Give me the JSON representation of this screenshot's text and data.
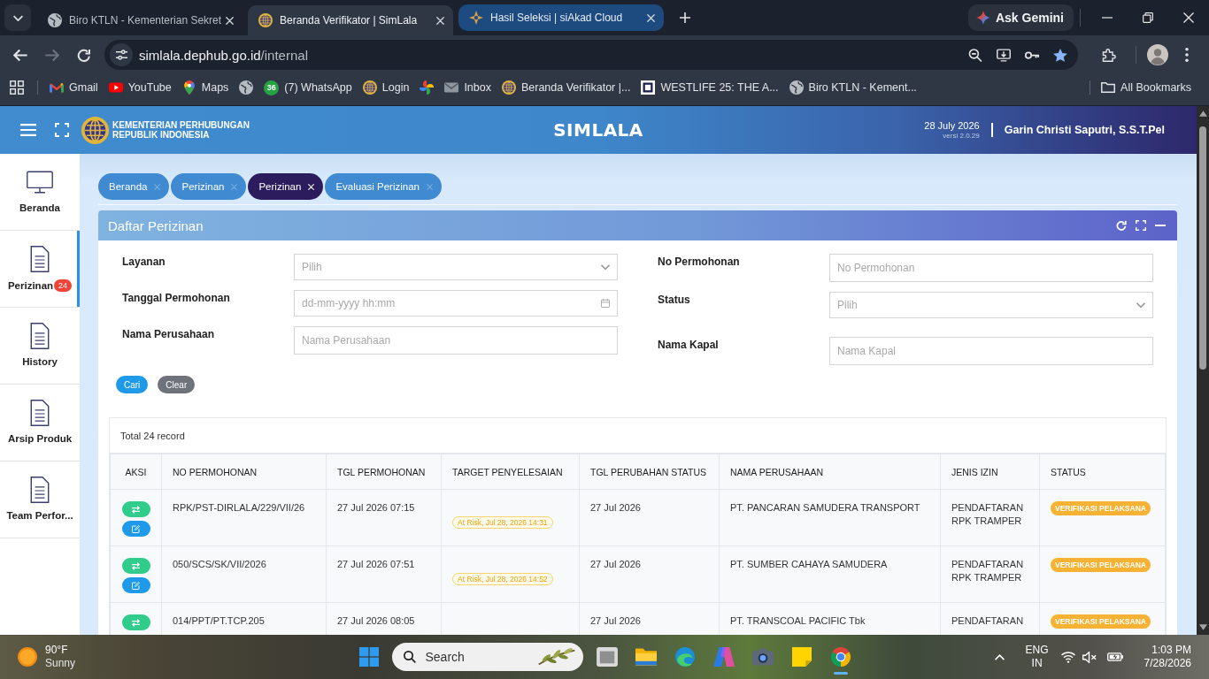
{
  "browser": {
    "tabs": [
      {
        "title": "Biro KTLN - Kementerian Sekret",
        "selected": false,
        "hovered": false
      },
      {
        "title": "Beranda Verifikator | SimLala",
        "selected": true,
        "hovered": false
      },
      {
        "title": "Hasil Seleksi | siAkad Cloud",
        "selected": false,
        "hovered": true
      }
    ],
    "gemini_button": "Ask Gemini",
    "forward_disabled": true,
    "url": {
      "host": "simlala.dephub.go.id",
      "path": "/internal"
    },
    "bookmarked": true,
    "bookmarks": [
      {
        "kind": "link",
        "label": "Gmail"
      },
      {
        "kind": "link",
        "label": "YouTube"
      },
      {
        "kind": "link",
        "label": "Maps"
      },
      {
        "kind": "icon"
      },
      {
        "kind": "link",
        "label": "(7) WhatsApp",
        "badge": "36"
      },
      {
        "kind": "link",
        "label": "Login"
      },
      {
        "kind": "icon"
      },
      {
        "kind": "link",
        "label": "Inbox"
      },
      {
        "kind": "link",
        "label": "Beranda Verifikator |..."
      },
      {
        "kind": "link",
        "label": "WESTLIFE 25: THE A..."
      },
      {
        "kind": "link",
        "label": "Biro KTLN - Kement..."
      }
    ],
    "all_bookmarks": "All Bookmarks"
  },
  "app": {
    "header": {
      "org_lines": [
        "KEMENTERIAN PERHUBUNGAN",
        "REPUBLIK INDONESIA"
      ],
      "title": "SIMLALA",
      "date": "28 July 2026",
      "version": "versi 2.0.29",
      "user": "Garin Christi Saputri, S.S.T.Pel"
    },
    "sidebar": [
      {
        "label": "Beranda",
        "selected": false
      },
      {
        "label": "Perizinan",
        "selected": true,
        "badge": "24"
      },
      {
        "label": "History",
        "selected": false
      },
      {
        "label": "Arsip Produk",
        "selected": false
      },
      {
        "label": "Team Perfor...",
        "selected": false
      }
    ],
    "page_tabs": [
      {
        "label": "Beranda",
        "selected": false
      },
      {
        "label": "Perizinan",
        "selected": false
      },
      {
        "label": "Perizinan",
        "selected": true
      },
      {
        "label": "Evaluasi Perizinan",
        "selected": false
      }
    ],
    "panel": {
      "title": "Daftar Perizinan",
      "filters_left": [
        {
          "label": "Layanan",
          "kind": "select",
          "placeholder": "Pilih"
        },
        {
          "label": "Tanggal Permohonan",
          "kind": "datetime",
          "placeholder": "dd-mm-yyyy hh:mm"
        },
        {
          "label": "Nama Perusahaan",
          "kind": "text",
          "placeholder": "Nama Perusahaan"
        }
      ],
      "filters_right": [
        {
          "label": "No Permohonan",
          "kind": "text",
          "placeholder": "No Permohonan"
        },
        {
          "label": "Status",
          "kind": "select",
          "placeholder": "Pilih"
        },
        {
          "label": "Nama Kapal",
          "kind": "text",
          "placeholder": "Nama Kapal"
        }
      ],
      "buttons": [
        {
          "label": "Cari",
          "kind": "primary"
        },
        {
          "label": "Clear",
          "kind": "secondary"
        }
      ],
      "table": {
        "total": "Total 24 record",
        "columns": [
          "AKSI",
          "NO PERMOHONAN",
          "TGL PERMOHONAN",
          "TARGET PENYELESAIAN",
          "TGL PERUBAHAN STATUS",
          "NAMA PERUSAHAAN",
          "JENIS IZIN",
          "STATUS"
        ],
        "rows": [
          {
            "actions": [
              {
                "kind": "transfer"
              },
              {
                "kind": "edit"
              }
            ],
            "number": "RPK/PST-DIRLALA/229/VII/26",
            "date": "27 Jul 2026 07:15",
            "target": "At Risk, Jul 28, 2026 14:31",
            "status_date": "27 Jul 2026",
            "company": "PT. PANCARAN SAMUDERA TRANSPORT",
            "permit_type": "PENDAFTARAN RPK TRAMPER",
            "status": "VERIFIKASI PELAKSANA"
          },
          {
            "actions": [
              {
                "kind": "transfer"
              },
              {
                "kind": "edit"
              }
            ],
            "number": "050/SCS/SK/VII/2026",
            "date": "27 Jul 2026 07:51",
            "target": "At Risk, Jul 28, 2026 14:52",
            "status_date": "27 Jul 2026",
            "company": "PT. SUMBER CAHAYA SAMUDERA",
            "permit_type": "PENDAFTARAN RPK TRAMPER",
            "status": "VERIFIKASI PELAKSANA"
          },
          {
            "actions": [
              {
                "kind": "transfer"
              }
            ],
            "number": "014/PPT/PT.TCP.205",
            "date": "27 Jul 2026 08:05",
            "status_date": "27 Jul 2026",
            "company": "PT. TRANSCOAL PACIFIC Tbk",
            "permit_type": "PENDAFTARAN",
            "status": "VERIFIKASI PELAKSANA"
          }
        ]
      }
    }
  },
  "taskbar": {
    "weather": {
      "temperature": "90°F",
      "condition": "Sunny"
    },
    "search_placeholder": "Search",
    "apps": [
      {
        "open": false
      },
      {
        "open": false
      },
      {
        "open": false
      },
      {
        "open": false
      },
      {
        "open": false
      },
      {
        "open": false
      },
      {
        "open": true
      }
    ],
    "language": "ENG",
    "region": "IN",
    "muted": true,
    "time": "1:03 PM",
    "date": "7/28/2026"
  }
}
